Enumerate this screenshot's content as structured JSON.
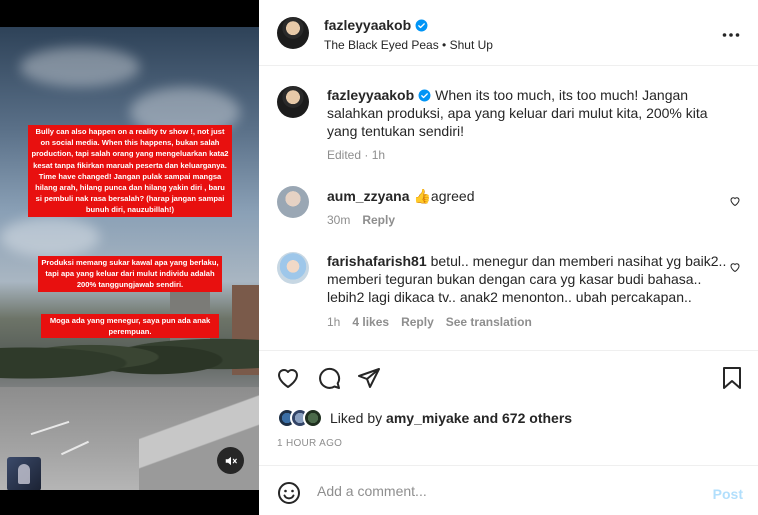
{
  "post": {
    "username": "fazleyyaakob",
    "audio": "The Black Eyed Peas • Shut Up",
    "more_icon": "more-horizontal-icon"
  },
  "video": {
    "caption_1": "Bully can also happen on a reality tv show !, not just on social media. When this happens, bukan salah production, tapi salah orang yang mengeluarkan kata2 kesat tanpa fikirkan maruah peserta dan keluarganya. Time have changed! Jangan pulak sampai mangsa hilang arah, hilang punca dan hilang yakin diri , baru si pembuli nak rasa bersalah? (harap jangan sampai bunuh diri, nauzubillah!)",
    "caption_2": "Produksi memang sukar kawal apa yang berlaku, tapi apa yang keluar dari mulut individu adalah 200% tanggungjawab sendiri.",
    "caption_3": "Moga ada yang menegur, saya pun ada anak perempuan.",
    "caption_color": "#e8100f"
  },
  "caption": {
    "username": "fazleyyaakob",
    "text": "When its too much, its too much! Jangan salahkan produksi, apa yang keluar dari mulut kita, 200% kita yang tentukan sendiri!",
    "meta": "Edited · 1h"
  },
  "comments": [
    {
      "username": "aum_zzyana",
      "text": "👍agreed",
      "time": "30m",
      "reply": "Reply"
    },
    {
      "username": "farishafarish81",
      "text": "betul.. menegur dan memberi nasihat yg baik2.. memberi teguran bukan dengan cara yg kasar budi bahasa.. lebih2 lagi dikaca tv.. anak2 menonton.. ubah percakapan..",
      "time": "1h",
      "likes": "4 likes",
      "reply": "Reply",
      "translate": "See translation"
    }
  ],
  "likes": {
    "prefix": "Liked by",
    "user": "amy_miyake",
    "suffix": "and 672 others"
  },
  "timestamp": "1 HOUR AGO",
  "comment_box": {
    "placeholder": "Add a comment...",
    "post_label": "Post"
  },
  "colors": {
    "verified": "#0095f6",
    "post_disabled": "#b2dffc",
    "secondary_text": "#8e8e8e"
  }
}
